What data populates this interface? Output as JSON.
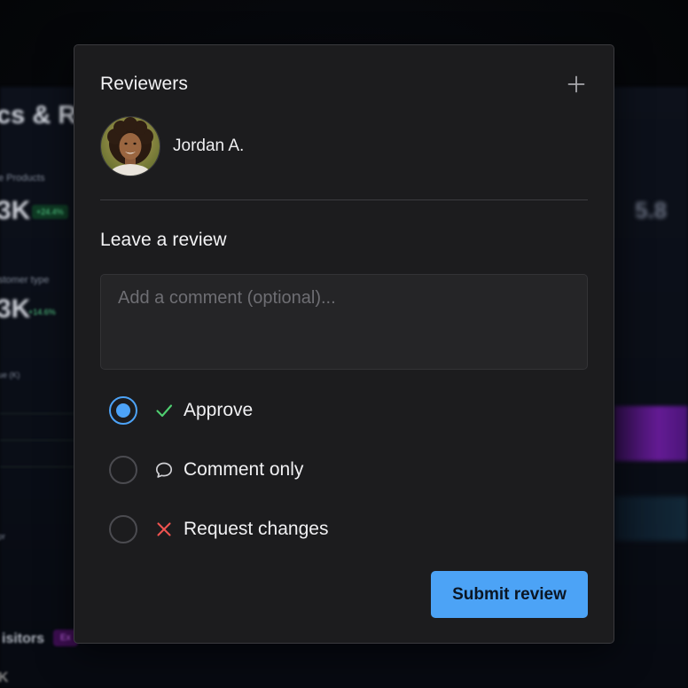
{
  "background": {
    "title_fragment": "cs & Re",
    "products_label": "e Products",
    "products_value": "3K",
    "products_change": "+24.4%",
    "customer_label": "stomer type",
    "customer_value": "3K",
    "customer_change": "+14.6%",
    "chart_label": "ue (K)",
    "month_label": "pr",
    "visitors_label": "isitors",
    "visitors_tag": "Ex",
    "bottom_value": "K",
    "right_value": "5.8"
  },
  "reviewers": {
    "title": "Reviewers",
    "add_icon": "plus-icon",
    "list": [
      {
        "name": "Jordan A.",
        "avatar": "avatar-photo"
      }
    ]
  },
  "review": {
    "title": "Leave a review",
    "comment_placeholder": "Add a comment (optional)...",
    "comment_value": "",
    "options": [
      {
        "label": "Approve",
        "icon": "check-icon",
        "icon_color": "#4fcf70",
        "checked": true
      },
      {
        "label": "Comment only",
        "icon": "speech-bubble-icon",
        "icon_color": "#d0d0d4",
        "checked": false
      },
      {
        "label": "Request changes",
        "icon": "x-icon",
        "icon_color": "#ef5350",
        "checked": false
      }
    ],
    "submit_label": "Submit review"
  },
  "colors": {
    "accent": "#4ca3f6",
    "modal_bg": "#1c1c1e",
    "approve_green": "#4fcf70",
    "reject_red": "#ef5350"
  }
}
